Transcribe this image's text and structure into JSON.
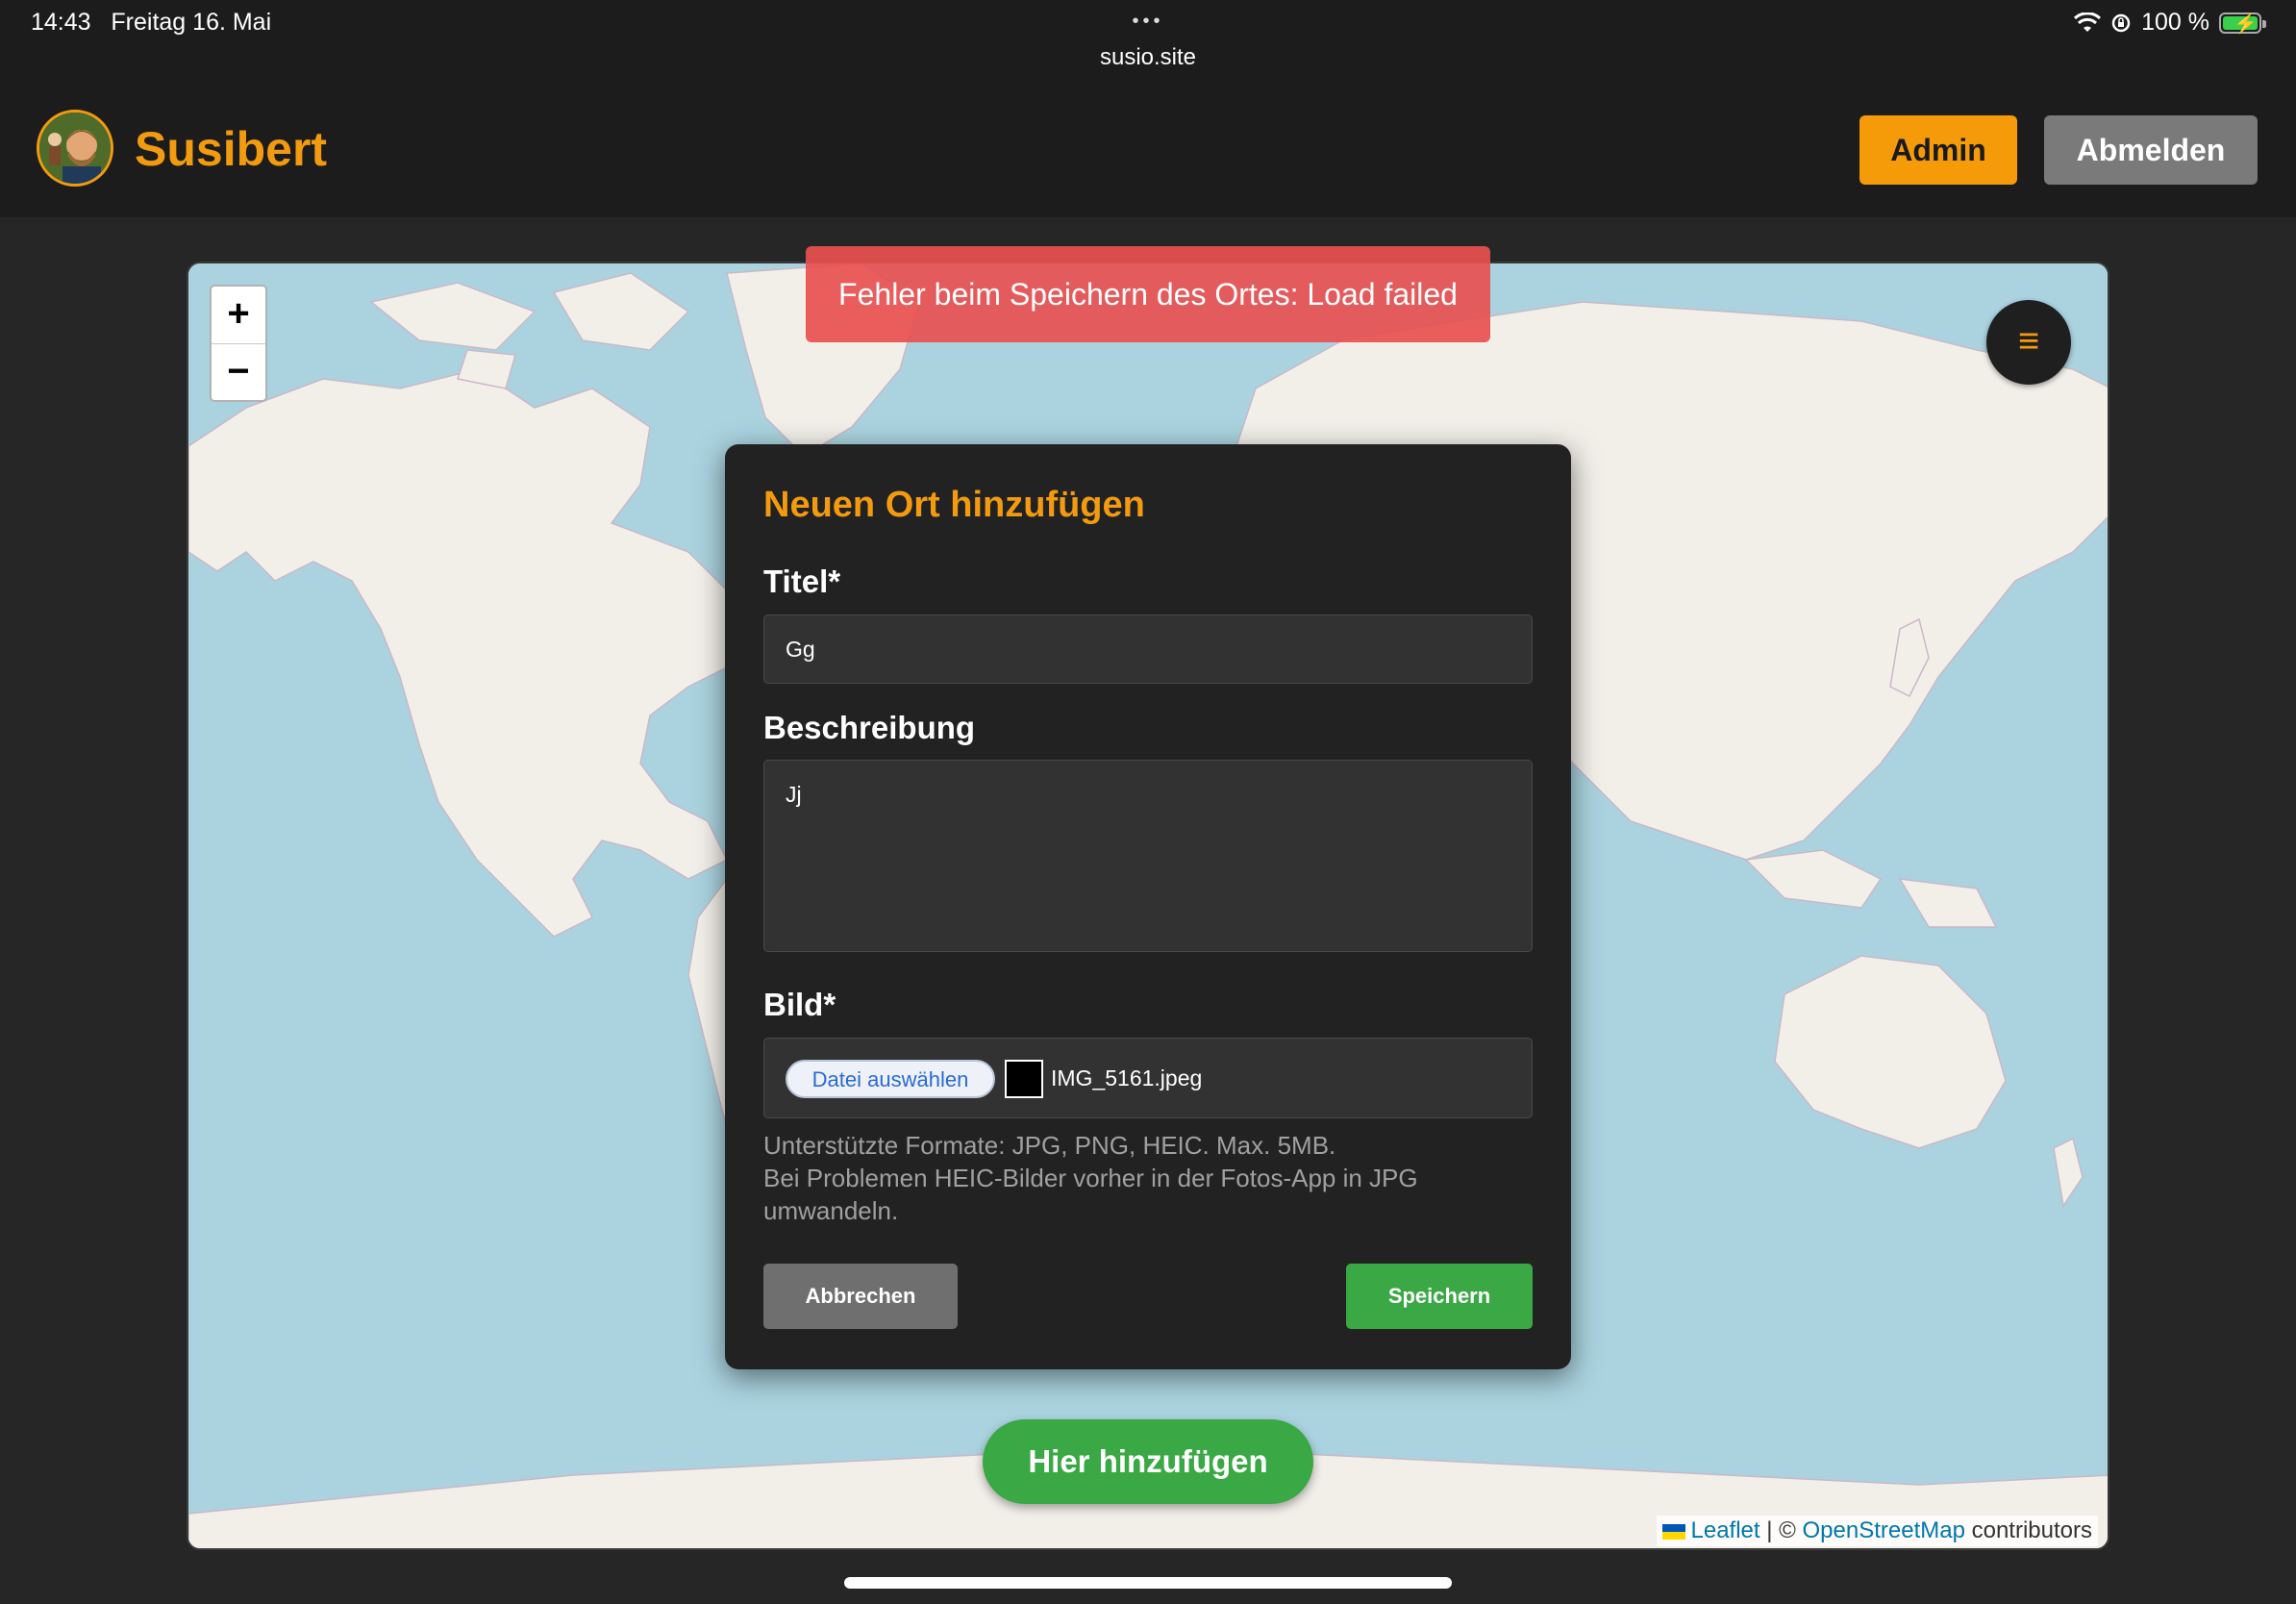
{
  "status_bar": {
    "time": "14:43",
    "date": "Freitag 16. Mai",
    "url": "susio.site",
    "dots": "•••",
    "battery": "100 %"
  },
  "header": {
    "brand": "Susibert",
    "admin_label": "Admin",
    "logout_label": "Abmelden"
  },
  "map": {
    "zoom_in": "+",
    "zoom_out": "−",
    "menu_icon": "≡",
    "attribution": {
      "leaflet": "Leaflet",
      "separator": " | © ",
      "osm": "OpenStreetMap",
      "suffix": " contributors"
    }
  },
  "toast": {
    "message": "Fehler beim Speichern des Ortes: Load failed"
  },
  "modal": {
    "title": "Neuen Ort hinzufügen",
    "title_label": "Titel*",
    "title_value": "Gg",
    "description_label": "Beschreibung",
    "description_value": "Jj",
    "image_label": "Bild*",
    "file_button": "Datei auswählen",
    "file_name": "IMG_5161.jpeg",
    "hint_line1": "Unterstützte Formate: JPG, PNG, HEIC. Max. 5MB.",
    "hint_line2": "Bei Problemen HEIC-Bilder vorher in der Fotos-App in JPG umwandeln.",
    "cancel_label": "Abbrechen",
    "save_label": "Speichern"
  },
  "add_here_label": "Hier hinzufügen",
  "colors": {
    "accent": "#f29a10",
    "success": "#3aa845",
    "error": "#e85050",
    "ocean": "#aad3df",
    "land": "#f2efe9"
  }
}
